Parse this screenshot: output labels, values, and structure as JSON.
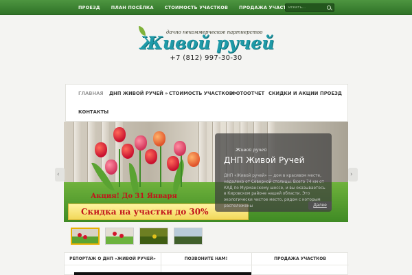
{
  "topnav": {
    "items": [
      {
        "label": "ПРОЕЗД"
      },
      {
        "label": "ПЛАН ПОСЁЛКА"
      },
      {
        "label": "СТОИМОСТЬ УЧАСТКОВ"
      },
      {
        "label": "ПРОДАЖА УЧАСТКОВ В ДНП"
      }
    ],
    "search_placeholder": "искать..."
  },
  "header": {
    "tagline": "дачно некоммерческое партнерство",
    "site_name": "Живой ручей",
    "phone": "+7 (812) 997-30-30"
  },
  "mainnav": {
    "items": [
      {
        "label": "ГЛАВНАЯ",
        "active": true
      },
      {
        "label": "ДНП ЖИВОЙ РУЧЕЙ »"
      },
      {
        "label": "СТОИМОСТЬ УЧАСТКОВ"
      },
      {
        "label": "ФОТООТЧЕТ"
      },
      {
        "label": "СКИДКИ И АКЦИИ"
      },
      {
        "label": "ПРОЕЗД"
      },
      {
        "label": "КОНТАКТЫ"
      }
    ]
  },
  "slider": {
    "promo_title": "Акция! До 31 Января",
    "promo_banner": "Скидка на участки до 30%",
    "caption": {
      "logo_text": "Живой ручей",
      "title": "ДНП Живой Ручей",
      "text": "ДНП «Живой ручей» — дом в красивом месте, недалеко от Северной столицы. Всего 74 км от КАД по Мурманскому шоссе, и вы оказываетесь в Кировском районе нашей области. Это экологически чистое место, рядом с которым расположены",
      "more_label": "Далее"
    },
    "prev_icon": "‹",
    "next_icon": "›"
  },
  "bottom_tabs": [
    {
      "label": "РЕПОРТАЖ О ДНП «ЖИВОЙ РУЧЕЙ»"
    },
    {
      "label": "ПОЗВОНИТЕ НАМ!"
    },
    {
      "label": "ПРОДАЖА УЧАСТКОВ"
    }
  ],
  "colors": {
    "topbar": "#3b8031",
    "logo_teal": "#1f9aa8",
    "promo_red": "#c2141b",
    "promo_yellow": "#f6e27a"
  }
}
